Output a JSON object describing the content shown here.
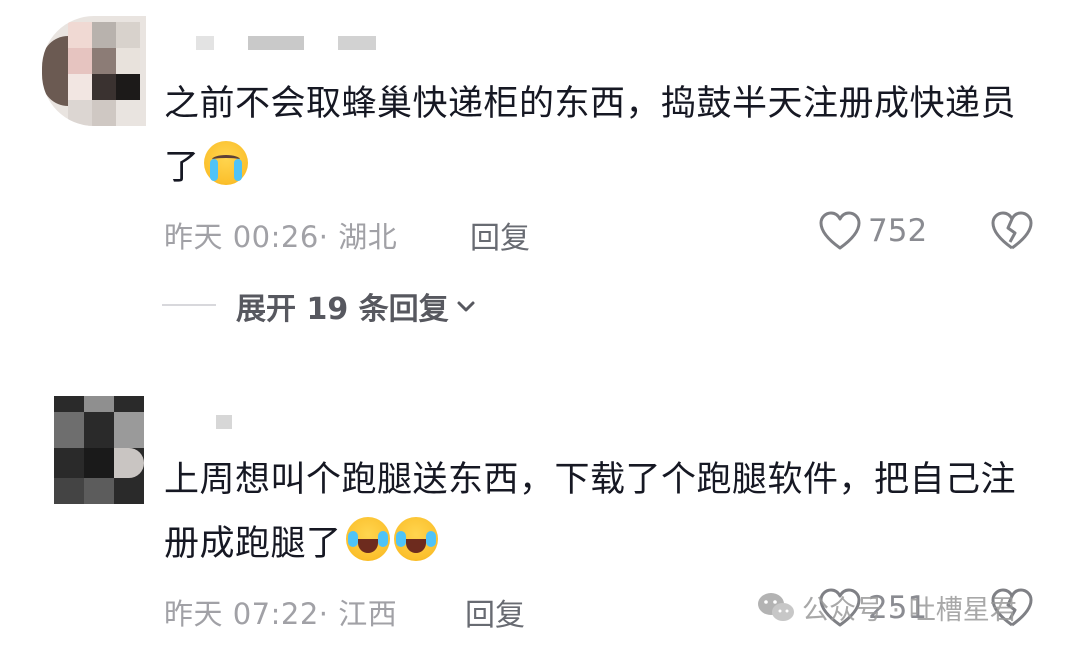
{
  "comments": [
    {
      "text": "之前不会取蜂巢快递柜的东西，捣鼓半天注册成快递员了",
      "emojis": [
        "loudly-crying-face"
      ],
      "time": "昨天 00:26",
      "location": "· 湖北",
      "reply_label": "回复",
      "likes": "752",
      "expand_label": "展开 19 条回复"
    },
    {
      "text": "上周想叫个跑腿送东西，下载了个跑腿软件，把自己注册成跑腿了",
      "emojis": [
        "face-with-tears-of-joy",
        "face-with-tears-of-joy"
      ],
      "time": "昨天 07:22",
      "location": "· 江西",
      "reply_label": "回复",
      "likes": "251"
    }
  ],
  "watermark": {
    "text": "公众号 · 吐槽星君",
    "icon": "wechat-icon"
  },
  "icons": {
    "like": "heart-outline-icon",
    "dislike": "broken-heart-icon",
    "expand": "chevron-down-icon"
  },
  "colors": {
    "text_primary": "#161823",
    "text_secondary": "#a1a1a6",
    "reply": "#686b72",
    "accent_emoji": "#fbc02d"
  }
}
